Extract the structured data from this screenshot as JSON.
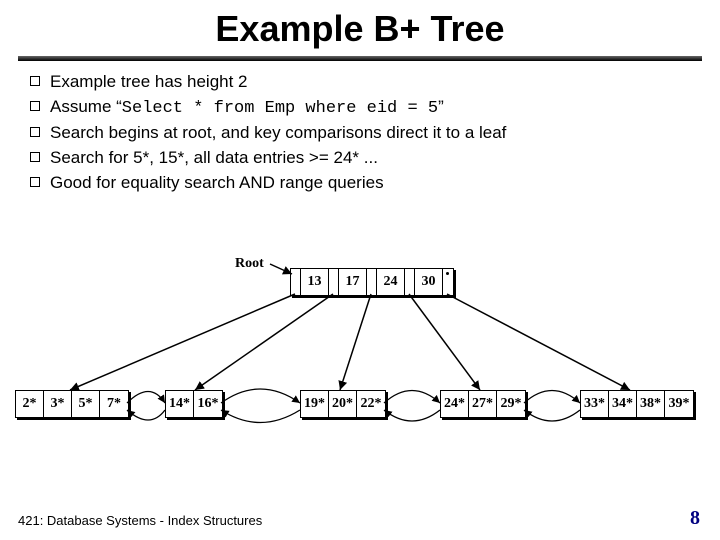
{
  "title": "Example B+ Tree",
  "bullets": [
    {
      "pre": "Example tree has height 2",
      "mono": "",
      "post": ""
    },
    {
      "pre": "Assume “",
      "mono": "Select * from Emp where eid = 5",
      "post": "”"
    },
    {
      "pre": "Search begins at root, and key comparisons direct it to a leaf",
      "mono": "",
      "post": ""
    },
    {
      "pre": "Search for 5*, 15*, all data entries >= 24* ...",
      "mono": "",
      "post": ""
    },
    {
      "pre": "Good for equality search AND range queries",
      "mono": "",
      "post": ""
    }
  ],
  "tree": {
    "root_label": "Root",
    "root_keys": [
      "13",
      "17",
      "24",
      "30"
    ],
    "leaves": [
      [
        "2*",
        "3*",
        "5*",
        "7*"
      ],
      [
        "14*",
        "16*"
      ],
      [
        "19*",
        "20*",
        "22*"
      ],
      [
        "24*",
        "27*",
        "29*"
      ],
      [
        "33*",
        "34*",
        "38*",
        "39*"
      ]
    ]
  },
  "footer": "421: Database Systems - Index Structures",
  "page_number": "8"
}
